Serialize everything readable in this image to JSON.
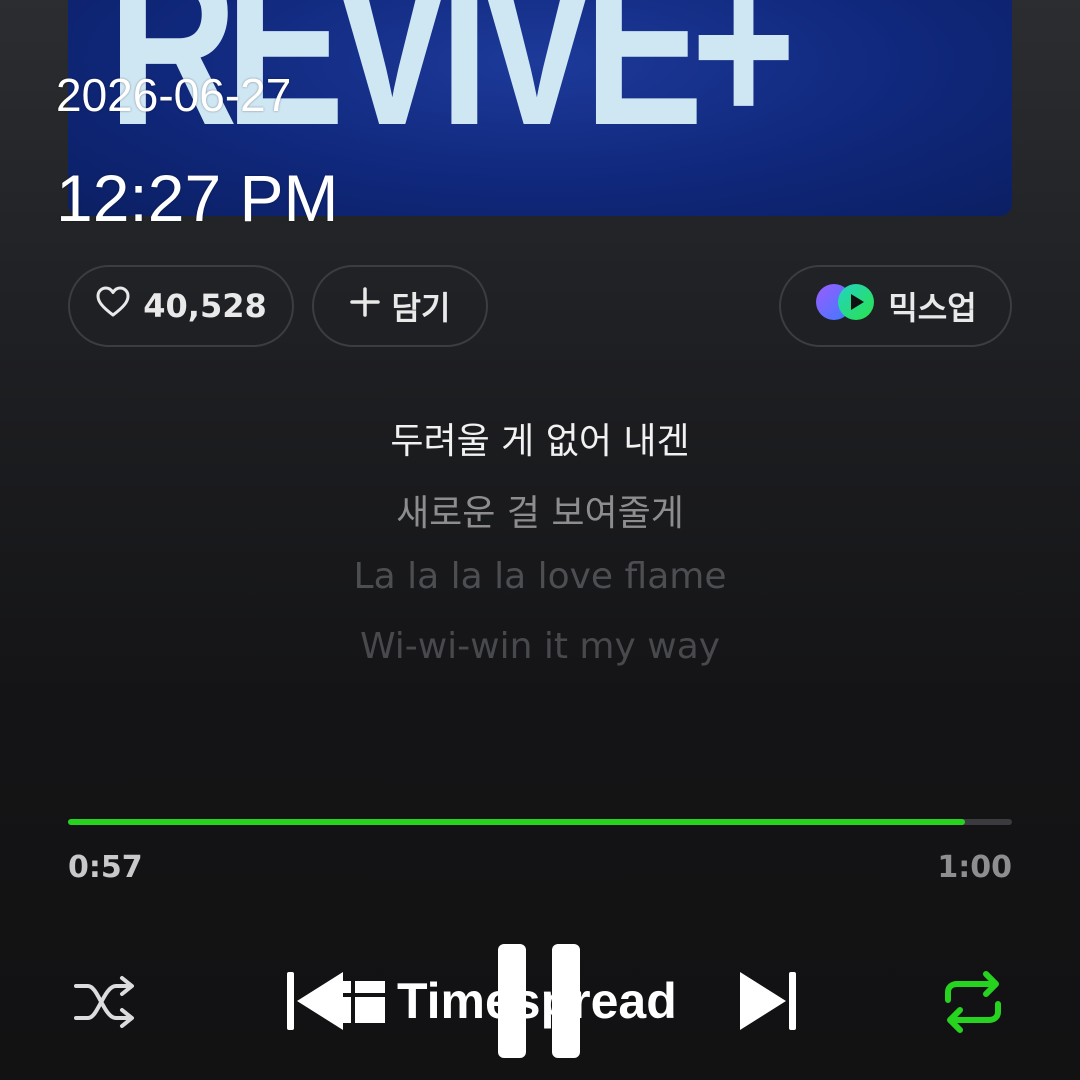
{
  "album_art": {
    "text": "REVIVE+"
  },
  "stamp": {
    "date": "2026-06-27",
    "time": "12:27 PM"
  },
  "actions": {
    "like_count": "40,528",
    "add_label": "담기",
    "mixup_label": "믹스업"
  },
  "lyrics": [
    "두려울 게 없어 내겐",
    "새로운 걸 보여줄게",
    "La la la la love flame",
    "Wi-wi-win it my way"
  ],
  "playback": {
    "current_time": "0:57",
    "total_time": "1:00",
    "progress_fraction": 0.95,
    "repeat_active": true
  },
  "watermark": {
    "text": "Timespread"
  },
  "colors": {
    "accent": "#26d420",
    "art_blue": "#10287c",
    "art_text": "#cfe6f3"
  },
  "icons": [
    "heart-icon",
    "plus-icon",
    "mixup-icon",
    "shuffle-icon",
    "previous-icon",
    "pause-icon",
    "next-icon",
    "repeat-icon"
  ]
}
